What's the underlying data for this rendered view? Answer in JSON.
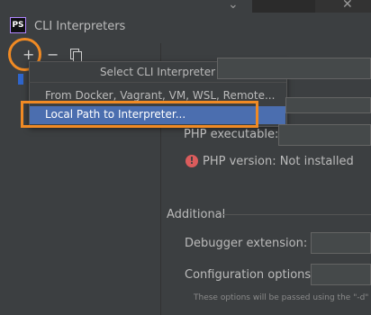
{
  "dialog": {
    "title": "CLI Interpreters",
    "logo_text": "PS"
  },
  "toolbar": {
    "add": "+",
    "remove": "−"
  },
  "popup": {
    "header": "Select CLI Interpreter",
    "items": [
      {
        "label": "From Docker, Vagrant, VM, WSL, Remote..."
      },
      {
        "label": "Local Path to Interpreter..."
      }
    ]
  },
  "form": {
    "php_executable_label": "PHP executable:",
    "php_version_text": "PHP version: Not installed",
    "additional_label": "Additional",
    "debugger_label": "Debugger extension:",
    "config_label": "Configuration options:",
    "hint": "These options will be passed using the \"-d\" com"
  },
  "colors": {
    "highlight": "#f08a24",
    "selection": "#4b6eaf",
    "error": "#db5c5c"
  },
  "icons": [
    "phpstorm-logo-icon",
    "add-icon",
    "remove-icon",
    "copy-icon",
    "error-icon",
    "close-icon"
  ]
}
